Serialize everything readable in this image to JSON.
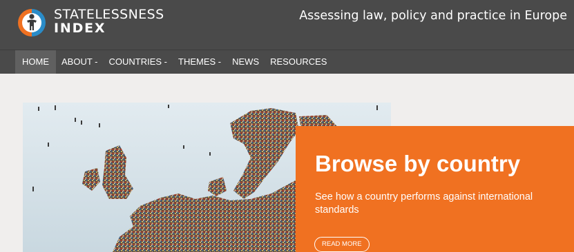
{
  "header": {
    "logo_line1": "STATELESSNESS",
    "logo_line2": "INDEX",
    "tagline": "Assessing law, policy and practice in Europe"
  },
  "nav": {
    "items": [
      {
        "label": "HOME",
        "active": true
      },
      {
        "label": "ABOUT -",
        "active": false
      },
      {
        "label": "COUNTRIES -",
        "active": false
      },
      {
        "label": "THEMES -",
        "active": false
      },
      {
        "label": "NEWS",
        "active": false
      },
      {
        "label": "RESOURCES",
        "active": false
      }
    ]
  },
  "promo": {
    "title": "Browse by country",
    "description": "See how a country performs against international standards",
    "button_label": "READ MORE"
  },
  "colors": {
    "header_bg": "#4a4a4a",
    "nav_active_bg": "#606060",
    "promo_bg": "#f07121",
    "page_bg": "#f0eeed",
    "logo_orange": "#f07121",
    "logo_blue": "#2a8cc8"
  },
  "icons": {
    "logo": "stateless-person-logo-icon"
  }
}
